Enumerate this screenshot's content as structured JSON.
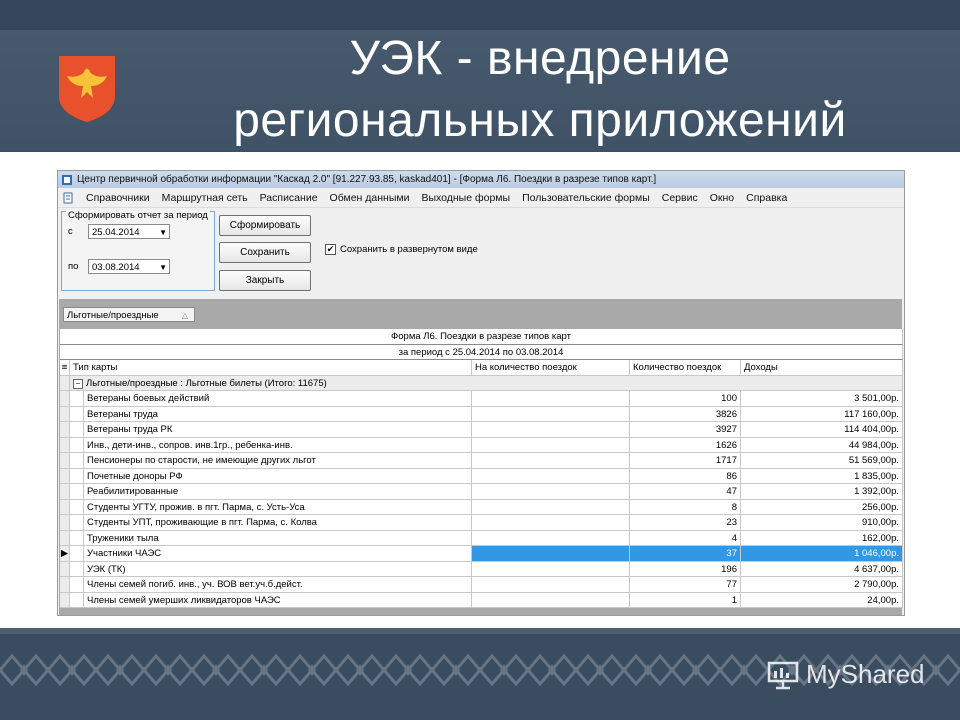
{
  "slide": {
    "title_line1": "УЭК - внедрение",
    "title_line2": "региональных приложений",
    "watermark": "MyShared",
    "emblem_icon": "komi-coat-of-arms-icon",
    "watermark_icon": "presentation-board-icon"
  },
  "window": {
    "title": "Центр первичной обработки информации \"Каскад 2.0\" [91.227.93.85,  kaskad401] - [Форма Л6. Поездки в разрезе типов карт.]",
    "menu": [
      "Справочники",
      "Маршрутная сеть",
      "Расписание",
      "Обмен данными",
      "Выходные формы",
      "Пользовательские формы",
      "Сервис",
      "Окно",
      "Справка"
    ]
  },
  "params": {
    "group_label": "Сформировать отчет за период",
    "from_label": "с",
    "from_value": "25.04.2014",
    "to_label": "по",
    "to_value": "03.08.2014"
  },
  "buttons": {
    "generate": "Сформировать",
    "save": "Сохранить",
    "close": "Закрыть"
  },
  "checkbox": {
    "label": "Сохранить в развернутом виде",
    "checked": true,
    "mark": "✔"
  },
  "grid": {
    "group_box": "Льготные/проездные",
    "report_title": "Форма Л6. Поездки в разрезе типов карт",
    "report_period": "за период с 25.04.2014 по 03.08.2014",
    "columns": [
      "Тип карты",
      "На количество поездок",
      "Количество поездок",
      "Доходы"
    ],
    "group_row": "Льготные/проездные : Льготные билеты (Итого: 11675)",
    "selected_index": 10,
    "rows": [
      {
        "name": "Ветераны боевых действий",
        "trips": "",
        "count": "100",
        "income": "3 501,00р."
      },
      {
        "name": "Ветераны труда",
        "trips": "",
        "count": "3826",
        "income": "117 160,00р."
      },
      {
        "name": "Ветераны труда РК",
        "trips": "",
        "count": "3927",
        "income": "114 404,00р."
      },
      {
        "name": "Инв., дети-инв., сопров. инв.1гр., ребенка-инв.",
        "trips": "",
        "count": "1626",
        "income": "44 984,00р."
      },
      {
        "name": "Пенсионеры по старости, не имеющие других льгот",
        "trips": "",
        "count": "1717",
        "income": "51 569,00р."
      },
      {
        "name": "Почетные доноры РФ",
        "trips": "",
        "count": "86",
        "income": "1 835,00р."
      },
      {
        "name": "Реабилитированные",
        "trips": "",
        "count": "47",
        "income": "1 392,00р."
      },
      {
        "name": "Студенты УГТУ, прожив. в пгт. Парма, с. Усть-Уса",
        "trips": "",
        "count": "8",
        "income": "256,00р."
      },
      {
        "name": "Студенты УПТ, проживающие в пгт. Парма, с. Колва",
        "trips": "",
        "count": "23",
        "income": "910,00р."
      },
      {
        "name": "Труженики тыла",
        "trips": "",
        "count": "4",
        "income": "162,00р."
      },
      {
        "name": "Участники ЧАЭС",
        "trips": "",
        "count": "37",
        "income": "1 046,00р."
      },
      {
        "name": "УЭК (ТК)",
        "trips": "",
        "count": "196",
        "income": "4 637,00р."
      },
      {
        "name": "Члены семей погиб. инв., уч. ВОВ вет.уч.б.дейст.",
        "trips": "",
        "count": "77",
        "income": "2 790,00р."
      },
      {
        "name": "Члены семей умерших ликвидаторов ЧАЭС",
        "trips": "",
        "count": "1",
        "income": "24,00р."
      }
    ]
  },
  "colors": {
    "selection": "#3398e3",
    "slide_background": "#3d4f62",
    "emblem": "#e8512b"
  }
}
